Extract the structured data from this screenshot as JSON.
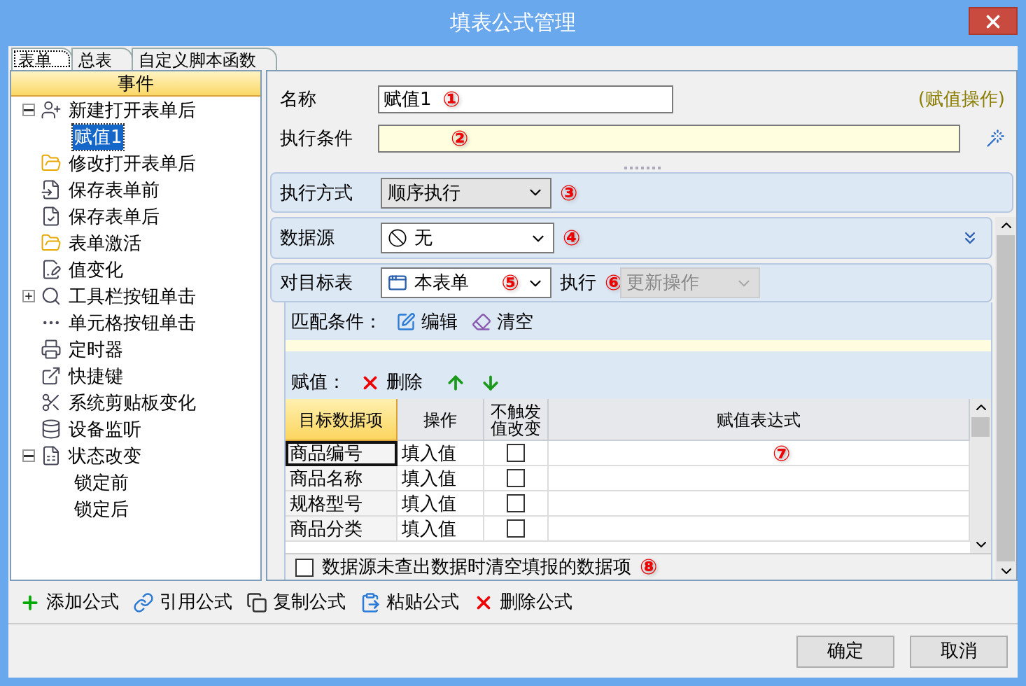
{
  "window": {
    "title": "填表公式管理"
  },
  "tabs": [
    {
      "label": "表单",
      "selected": true
    },
    {
      "label": "总表",
      "selected": false
    },
    {
      "label": "自定义脚本函数",
      "selected": false
    }
  ],
  "events": {
    "header": "事件",
    "items": [
      {
        "label": "新建打开表单后",
        "kind": "user-plus",
        "expanded": true,
        "selected": false,
        "children": [
          {
            "label": "赋值1",
            "selected": true
          }
        ]
      },
      {
        "label": "修改打开表单后",
        "kind": "folder",
        "selected": false
      },
      {
        "label": "保存表单前",
        "kind": "save-in",
        "selected": false
      },
      {
        "label": "保存表单后",
        "kind": "save-check",
        "selected": false
      },
      {
        "label": "表单激活",
        "kind": "folder",
        "selected": false
      },
      {
        "label": "值变化",
        "kind": "value",
        "selected": false
      },
      {
        "label": "工具栏按钮单击",
        "kind": "tool",
        "expanded": false,
        "selected": false
      },
      {
        "label": "单元格按钮单击",
        "kind": "dots",
        "selected": false
      },
      {
        "label": "定时器",
        "kind": "printer",
        "selected": false
      },
      {
        "label": "快捷键",
        "kind": "shortcut",
        "selected": false
      },
      {
        "label": "系统剪贴板变化",
        "kind": "scissors",
        "selected": false
      },
      {
        "label": "设备监听",
        "kind": "database",
        "selected": false
      },
      {
        "label": "状态改变",
        "kind": "sheet",
        "expanded": true,
        "selected": false,
        "children": [
          {
            "label": "锁定前",
            "selected": false
          },
          {
            "label": "锁定后",
            "selected": false
          }
        ]
      }
    ]
  },
  "formula": {
    "name": {
      "label": "名称",
      "value": "赋值1",
      "marker": "①"
    },
    "operation": "(赋值操作)",
    "condition": {
      "label": "执行条件",
      "marker": "②"
    }
  },
  "exec_mode": {
    "label": "执行方式",
    "value": "顺序执行",
    "marker": "③"
  },
  "data_source": {
    "label": "数据源",
    "value": "无",
    "marker": "④"
  },
  "target": {
    "label": "对目标表",
    "value": "本表单",
    "marker": "⑤",
    "action_label": "执行",
    "action_marker": "⑥",
    "action_value": "更新操作",
    "action_disabled": true
  },
  "match": {
    "label": "匹配条件：",
    "buttons": [
      {
        "kind": "edit",
        "label": "编辑"
      },
      {
        "kind": "clear",
        "label": "清空"
      }
    ]
  },
  "assign": {
    "label": "赋值：",
    "buttons": [
      {
        "kind": "delete",
        "label": "删除"
      },
      {
        "kind": "up"
      },
      {
        "kind": "down"
      }
    ]
  },
  "table": {
    "columns": [
      {
        "label": "目标数据项",
        "selected": true
      },
      {
        "label": "操作",
        "selected": false
      },
      {
        "label": "不触发值改变",
        "selected": false
      },
      {
        "label": "赋值表达式",
        "selected": false
      }
    ],
    "rows": [
      {
        "item": "商品编号",
        "operation": "填入值",
        "no_trigger": false,
        "current": true,
        "marker": "⑦"
      },
      {
        "item": "商品名称",
        "operation": "填入值",
        "no_trigger": false,
        "current": false
      },
      {
        "item": "规格型号",
        "operation": "填入值",
        "no_trigger": false,
        "current": false
      },
      {
        "item": "商品分类",
        "operation": "填入值",
        "no_trigger": false,
        "current": false
      }
    ]
  },
  "option": {
    "label": "数据源未查出数据时清空填报的数据项",
    "checked": false,
    "marker": "⑧"
  },
  "toolbar": [
    {
      "kind": "add",
      "label": "添加公式"
    },
    {
      "kind": "link",
      "label": "引用公式"
    },
    {
      "kind": "copy",
      "label": "复制公式"
    },
    {
      "kind": "paste",
      "label": "粘贴公式"
    },
    {
      "kind": "delete",
      "label": "删除公式"
    }
  ],
  "buttons": [
    "确定",
    "取消"
  ]
}
